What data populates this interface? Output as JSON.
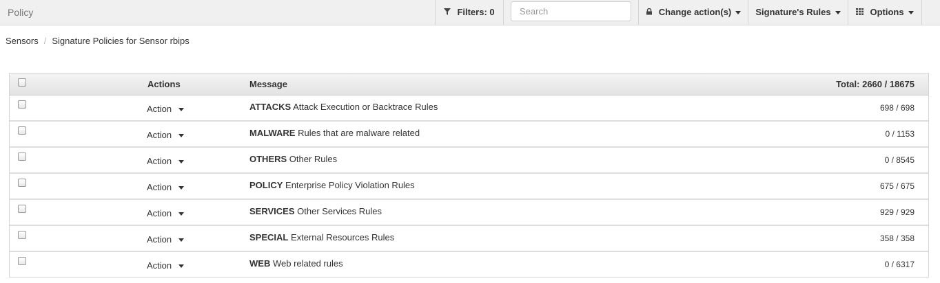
{
  "app": {
    "title": "Policy"
  },
  "toolbar": {
    "filters_label": "Filters: 0",
    "search_placeholder": "Search",
    "change_actions_label": "Change action(s)",
    "signature_rules_label": "Signature's Rules",
    "options_label": "Options"
  },
  "breadcrumb": {
    "root": "Sensors",
    "current": "Signature Policies for Sensor rbips"
  },
  "table": {
    "headers": {
      "actions": "Actions",
      "message": "Message",
      "total": "Total: 2660 / 18675"
    },
    "rows": [
      {
        "action": "Action",
        "category": "ATTACKS",
        "description": "Attack Execution or Backtrace Rules",
        "count": "698 / 698"
      },
      {
        "action": "Action",
        "category": "MALWARE",
        "description": "Rules that are malware related",
        "count": "0 / 1153"
      },
      {
        "action": "Action",
        "category": "OTHERS",
        "description": "Other Rules",
        "count": "0 / 8545"
      },
      {
        "action": "Action",
        "category": "POLICY",
        "description": "Enterprise Policy Violation Rules",
        "count": "675 / 675"
      },
      {
        "action": "Action",
        "category": "SERVICES",
        "description": "Other Services Rules",
        "count": "929 / 929"
      },
      {
        "action": "Action",
        "category": "SPECIAL",
        "description": "External Resources Rules",
        "count": "358 / 358"
      },
      {
        "action": "Action",
        "category": "WEB",
        "description": "Web related rules",
        "count": "0 / 6317"
      }
    ]
  },
  "icons": {
    "filter": "filter-icon",
    "change_action": "lock-icon",
    "options": "grid-icon",
    "dropdown": "caret-down-icon"
  }
}
